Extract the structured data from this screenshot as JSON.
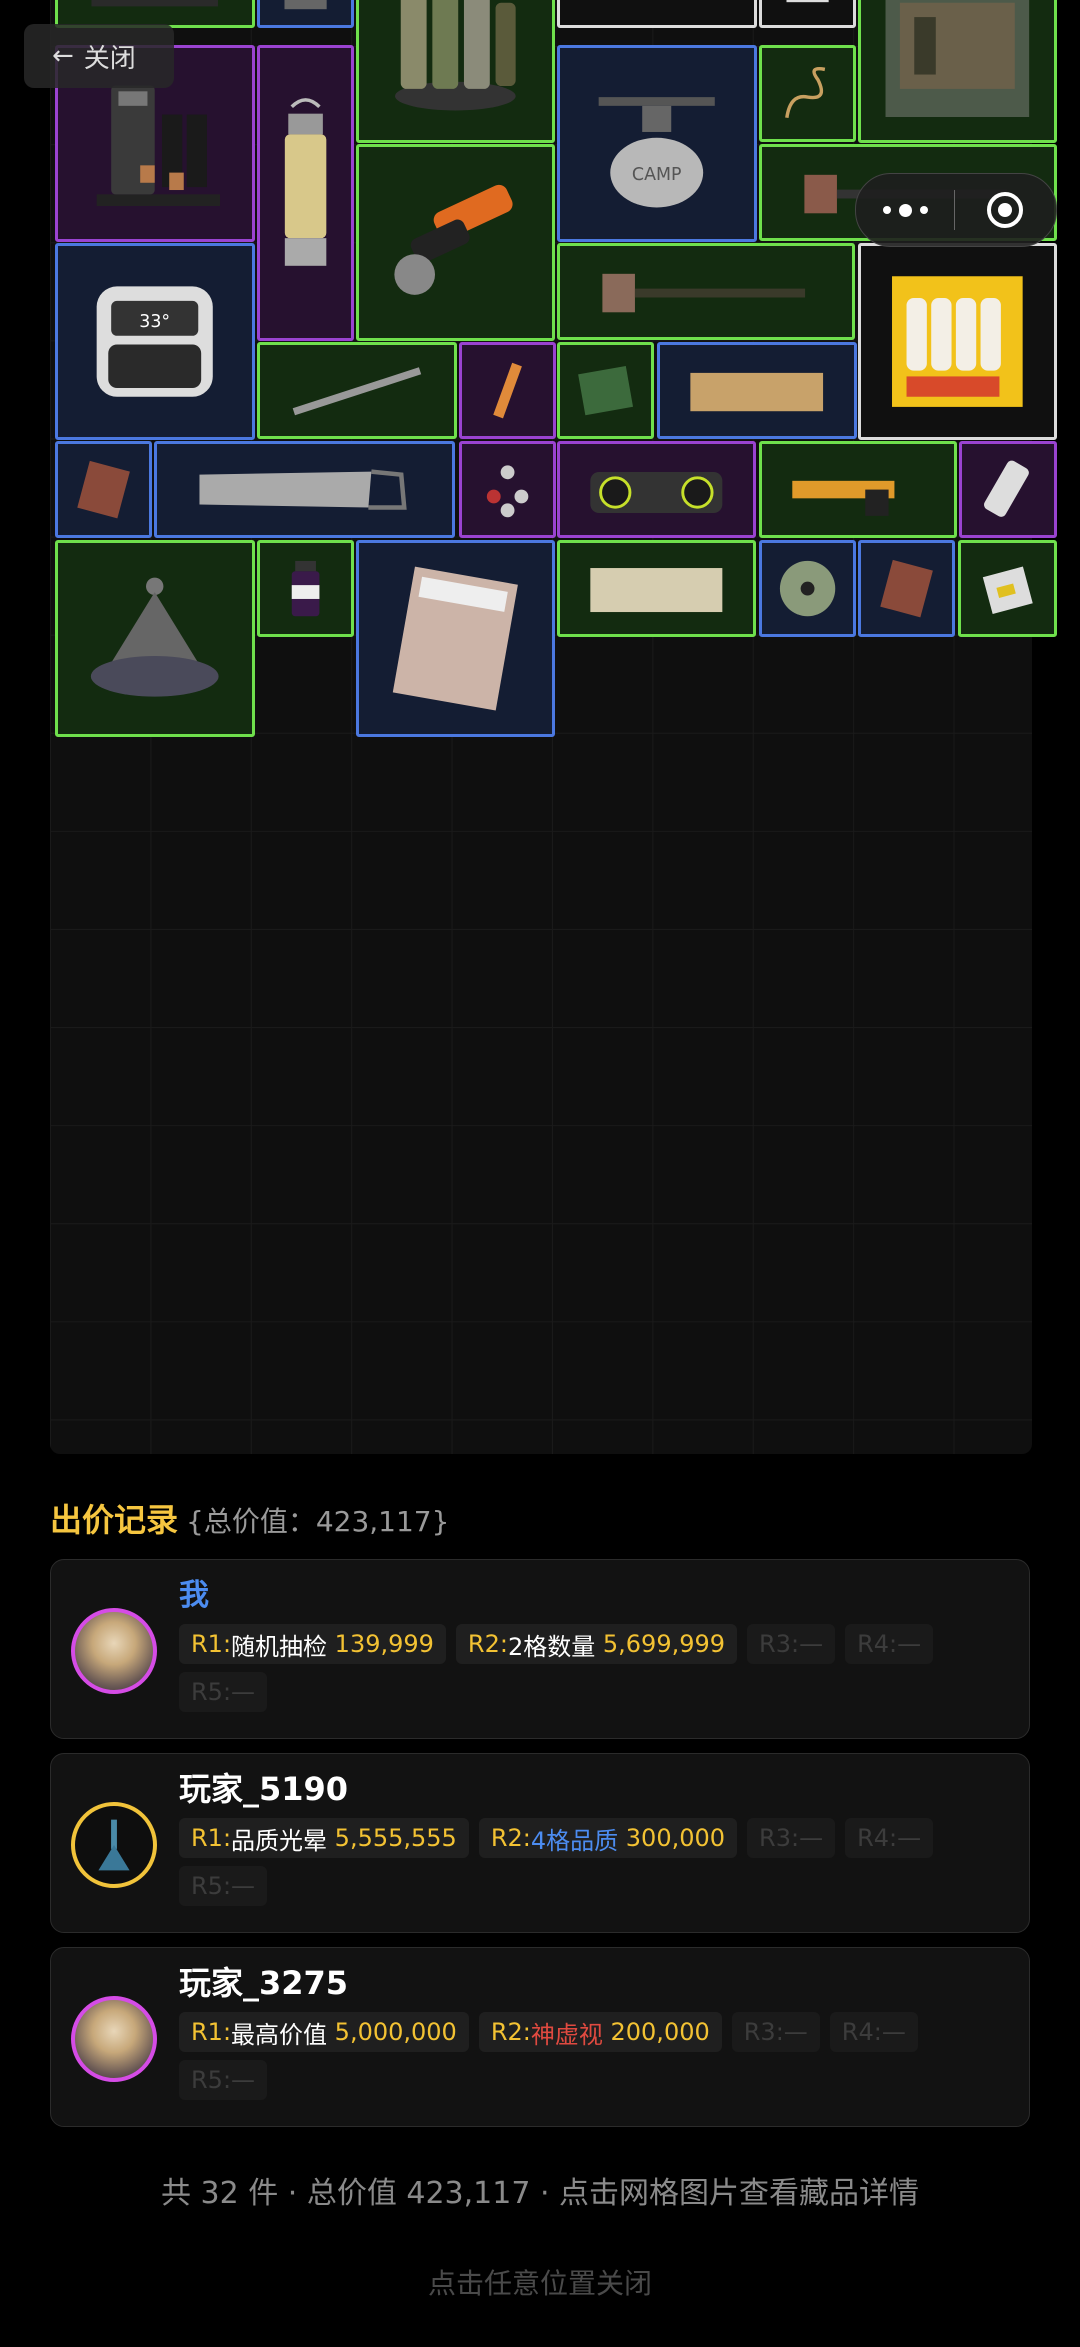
{
  "nav": {
    "back_label": "关闭"
  },
  "colors": {
    "accent_gold": "#f6c640",
    "quality_green": "#6fe04c",
    "quality_blue": "#4b78e0",
    "quality_purple": "#9a43d1",
    "name_blue": "#4c8cf0",
    "warn_red": "#e04a40"
  },
  "bids": {
    "title": "出价记录",
    "total_label": "{总价值：423,117}",
    "players": [
      {
        "name": "我",
        "avatar": "pink",
        "rounds": [
          {
            "tag": "R1:",
            "desc": "随机抽检",
            "desc_color": "white",
            "amount": "139,999"
          },
          {
            "tag": "R2:",
            "desc": "2格数量",
            "desc_color": "white",
            "amount": "5,699,999"
          },
          {
            "tag": "R3:—",
            "empty": true
          },
          {
            "tag": "R4:—",
            "empty": true
          },
          {
            "tag": "R5:—",
            "empty": true
          }
        ]
      },
      {
        "name": "玩家_5190",
        "avatar": "gold",
        "rounds": [
          {
            "tag": "R1:",
            "desc": "品质光晕",
            "desc_color": "white",
            "amount": "5,555,555"
          },
          {
            "tag": "R2:",
            "desc": "4格品质",
            "desc_color": "blue",
            "amount": "300,000"
          },
          {
            "tag": "R3:—",
            "empty": true
          },
          {
            "tag": "R4:—",
            "empty": true
          },
          {
            "tag": "R5:—",
            "empty": true
          }
        ]
      },
      {
        "name": "玩家_3275",
        "avatar": "pink",
        "rounds": [
          {
            "tag": "R1:",
            "desc": "最高价值",
            "desc_color": "white",
            "amount": "5,000,000"
          },
          {
            "tag": "R2:",
            "desc": "神虚视",
            "desc_color": "red",
            "amount": "200,000"
          },
          {
            "tag": "R3:—",
            "empty": true
          },
          {
            "tag": "R4:—",
            "empty": true
          },
          {
            "tag": "R5:—",
            "empty": true
          }
        ]
      }
    ]
  },
  "footer": {
    "summary": "共 32 件 · 总价值 423,117 · 点击网格图片查看藏品详情",
    "close_hint": "点击任意位置关闭"
  }
}
